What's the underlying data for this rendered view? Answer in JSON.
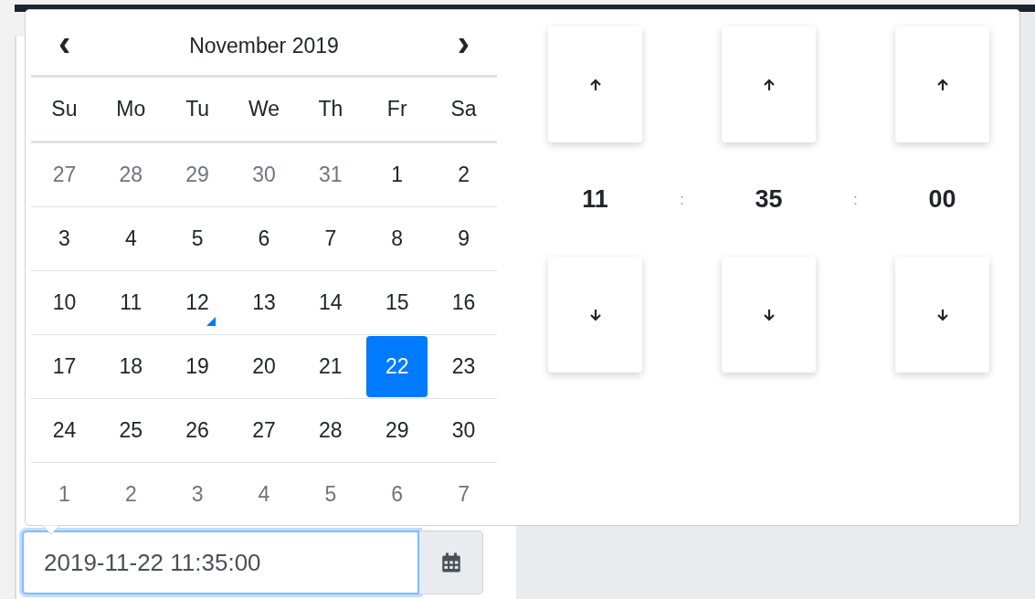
{
  "calendar": {
    "month_title": "November 2019",
    "prev_label": "‹",
    "next_label": "›",
    "weekdays": [
      "Su",
      "Mo",
      "Tu",
      "We",
      "Th",
      "Fr",
      "Sa"
    ],
    "weeks": [
      [
        {
          "day": "27",
          "muted": true,
          "selected": false,
          "today": false
        },
        {
          "day": "28",
          "muted": true,
          "selected": false,
          "today": false
        },
        {
          "day": "29",
          "muted": true,
          "selected": false,
          "today": false
        },
        {
          "day": "30",
          "muted": true,
          "selected": false,
          "today": false
        },
        {
          "day": "31",
          "muted": true,
          "selected": false,
          "today": false
        },
        {
          "day": "1",
          "muted": false,
          "selected": false,
          "today": false
        },
        {
          "day": "2",
          "muted": false,
          "selected": false,
          "today": false
        }
      ],
      [
        {
          "day": "3",
          "muted": false,
          "selected": false,
          "today": false
        },
        {
          "day": "4",
          "muted": false,
          "selected": false,
          "today": false
        },
        {
          "day": "5",
          "muted": false,
          "selected": false,
          "today": false
        },
        {
          "day": "6",
          "muted": false,
          "selected": false,
          "today": false
        },
        {
          "day": "7",
          "muted": false,
          "selected": false,
          "today": false
        },
        {
          "day": "8",
          "muted": false,
          "selected": false,
          "today": false
        },
        {
          "day": "9",
          "muted": false,
          "selected": false,
          "today": false
        }
      ],
      [
        {
          "day": "10",
          "muted": false,
          "selected": false,
          "today": false
        },
        {
          "day": "11",
          "muted": false,
          "selected": false,
          "today": false
        },
        {
          "day": "12",
          "muted": false,
          "selected": false,
          "today": true
        },
        {
          "day": "13",
          "muted": false,
          "selected": false,
          "today": false
        },
        {
          "day": "14",
          "muted": false,
          "selected": false,
          "today": false
        },
        {
          "day": "15",
          "muted": false,
          "selected": false,
          "today": false
        },
        {
          "day": "16",
          "muted": false,
          "selected": false,
          "today": false
        }
      ],
      [
        {
          "day": "17",
          "muted": false,
          "selected": false,
          "today": false
        },
        {
          "day": "18",
          "muted": false,
          "selected": false,
          "today": false
        },
        {
          "day": "19",
          "muted": false,
          "selected": false,
          "today": false
        },
        {
          "day": "20",
          "muted": false,
          "selected": false,
          "today": false
        },
        {
          "day": "21",
          "muted": false,
          "selected": false,
          "today": false
        },
        {
          "day": "22",
          "muted": false,
          "selected": true,
          "today": false
        },
        {
          "day": "23",
          "muted": false,
          "selected": false,
          "today": false
        }
      ],
      [
        {
          "day": "24",
          "muted": false,
          "selected": false,
          "today": false
        },
        {
          "day": "25",
          "muted": false,
          "selected": false,
          "today": false
        },
        {
          "day": "26",
          "muted": false,
          "selected": false,
          "today": false
        },
        {
          "day": "27",
          "muted": false,
          "selected": false,
          "today": false
        },
        {
          "day": "28",
          "muted": false,
          "selected": false,
          "today": false
        },
        {
          "day": "29",
          "muted": false,
          "selected": false,
          "today": false
        },
        {
          "day": "30",
          "muted": false,
          "selected": false,
          "today": false
        }
      ],
      [
        {
          "day": "1",
          "muted": true,
          "selected": false,
          "today": false
        },
        {
          "day": "2",
          "muted": true,
          "selected": false,
          "today": false
        },
        {
          "day": "3",
          "muted": true,
          "selected": false,
          "today": false
        },
        {
          "day": "4",
          "muted": true,
          "selected": false,
          "today": false
        },
        {
          "day": "5",
          "muted": true,
          "selected": false,
          "today": false
        },
        {
          "day": "6",
          "muted": true,
          "selected": false,
          "today": false
        },
        {
          "day": "7",
          "muted": true,
          "selected": false,
          "today": false
        }
      ]
    ]
  },
  "time": {
    "units": [
      {
        "value": "11"
      },
      {
        "value": "35"
      },
      {
        "value": "00"
      }
    ],
    "separators": [
      ":",
      ":"
    ]
  },
  "input": {
    "value": "2019-11-22 11:35:00"
  }
}
